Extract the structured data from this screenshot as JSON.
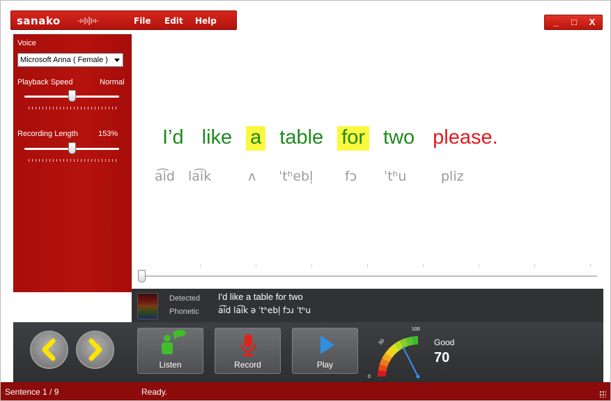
{
  "app": {
    "logo": "sanako"
  },
  "menu": [
    "File",
    "Edit",
    "Help"
  ],
  "window_controls": {
    "minimize": "_",
    "maximize": "□",
    "close": "X"
  },
  "sidebar": {
    "voice_label": "Voice",
    "voice_value": "Microsoft Anna ( Female )",
    "speed_label": "Playback Speed",
    "speed_value": "Normal",
    "speed_level": 0.5,
    "length_label": "Recording Length",
    "length_value": "153%",
    "length_level": 0.5
  },
  "sentence": {
    "words": [
      {
        "text": "I’d",
        "color": "green",
        "highlight": false
      },
      {
        "text": "like",
        "color": "green",
        "highlight": false
      },
      {
        "text": "a",
        "color": "green",
        "highlight": true
      },
      {
        "text": "table",
        "color": "green",
        "highlight": false
      },
      {
        "text": "for",
        "color": "green",
        "highlight": true
      },
      {
        "text": "two",
        "color": "green",
        "highlight": false
      },
      {
        "text": "please.",
        "color": "red",
        "highlight": false
      }
    ],
    "phonetics": [
      "a͡id",
      "la͡ik",
      "ʌ",
      "ˈtʰebl̩",
      "fɔ",
      "ˈtʰu",
      "pliz"
    ]
  },
  "detection": {
    "detected_label": "Detected",
    "detected_value": "I'd like a table for two",
    "phonetic_label": "Phonetic",
    "phonetic_value": "a͡id la͡ik ə ˈtʰebl̩ fɔɹ ˈtʰu"
  },
  "toolbar": {
    "listen_label": "Listen",
    "record_label": "Record",
    "play_label": "Play",
    "gauge": {
      "min_label": "0",
      "mid_label": "50",
      "max_label": "100",
      "value": 70
    },
    "score_label": "Good",
    "score_value": "70"
  },
  "status": {
    "sentence": "Sentence 1 / 9",
    "state": "Ready."
  },
  "colors": {
    "brand_red": "#b5120d",
    "correct": "#1d8a1d",
    "incorrect": "#e3191f",
    "highlight": "#fcf83e"
  }
}
